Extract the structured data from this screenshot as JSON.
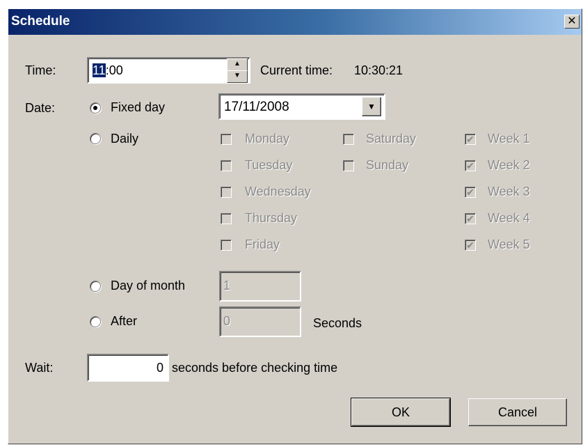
{
  "window": {
    "title": "Schedule",
    "close_glyph": "✕"
  },
  "time": {
    "label": "Time:",
    "hours_selected": "11",
    "rest": ":00",
    "current_time_label": "Current time:",
    "current_time_value": "10:30:21",
    "spin_up": "▲",
    "spin_down": "▼"
  },
  "date": {
    "label": "Date:",
    "fixed_day_label": "Fixed day",
    "fixed_day_value": "17/11/2008",
    "dropdown_glyph": "▼",
    "daily_label": "Daily",
    "weekdays": [
      "Monday",
      "Tuesday",
      "Wednesday",
      "Thursday",
      "Friday"
    ],
    "weekend": [
      "Saturday",
      "Sunday"
    ],
    "weeks": [
      "Week 1",
      "Week 2",
      "Week 3",
      "Week 4",
      "Week 5"
    ],
    "check_glyph": "✔",
    "day_of_month_label": "Day of month",
    "day_of_month_value": "1",
    "after_label": "After",
    "after_value": "0",
    "seconds_label": "Seconds"
  },
  "wait": {
    "label": "Wait:",
    "value": "0",
    "suffix": "seconds before checking time"
  },
  "buttons": {
    "ok": "OK",
    "cancel": "Cancel"
  }
}
